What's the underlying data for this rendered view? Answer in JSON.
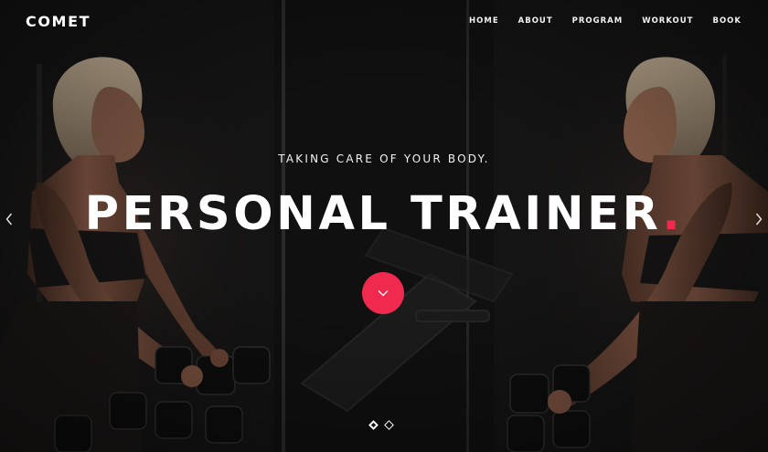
{
  "brand": {
    "name": "COMET"
  },
  "nav": {
    "items": [
      {
        "label": "HOME"
      },
      {
        "label": "ABOUT"
      },
      {
        "label": "PROGRAM"
      },
      {
        "label": "WORKOUT"
      },
      {
        "label": "BOOK"
      }
    ]
  },
  "hero": {
    "tagline": "TAKING CARE OF YOUR BODY.",
    "headline": "PERSONAL TRAINER",
    "headline_dot": ".",
    "scroll_icon": "chevron-down-icon",
    "prev_icon": "chevron-left-icon",
    "next_icon": "chevron-right-icon",
    "slides": [
      {
        "active": true
      },
      {
        "active": false
      }
    ]
  },
  "colors": {
    "accent": "#f0294f",
    "background": "#141414",
    "text": "#ffffff"
  }
}
